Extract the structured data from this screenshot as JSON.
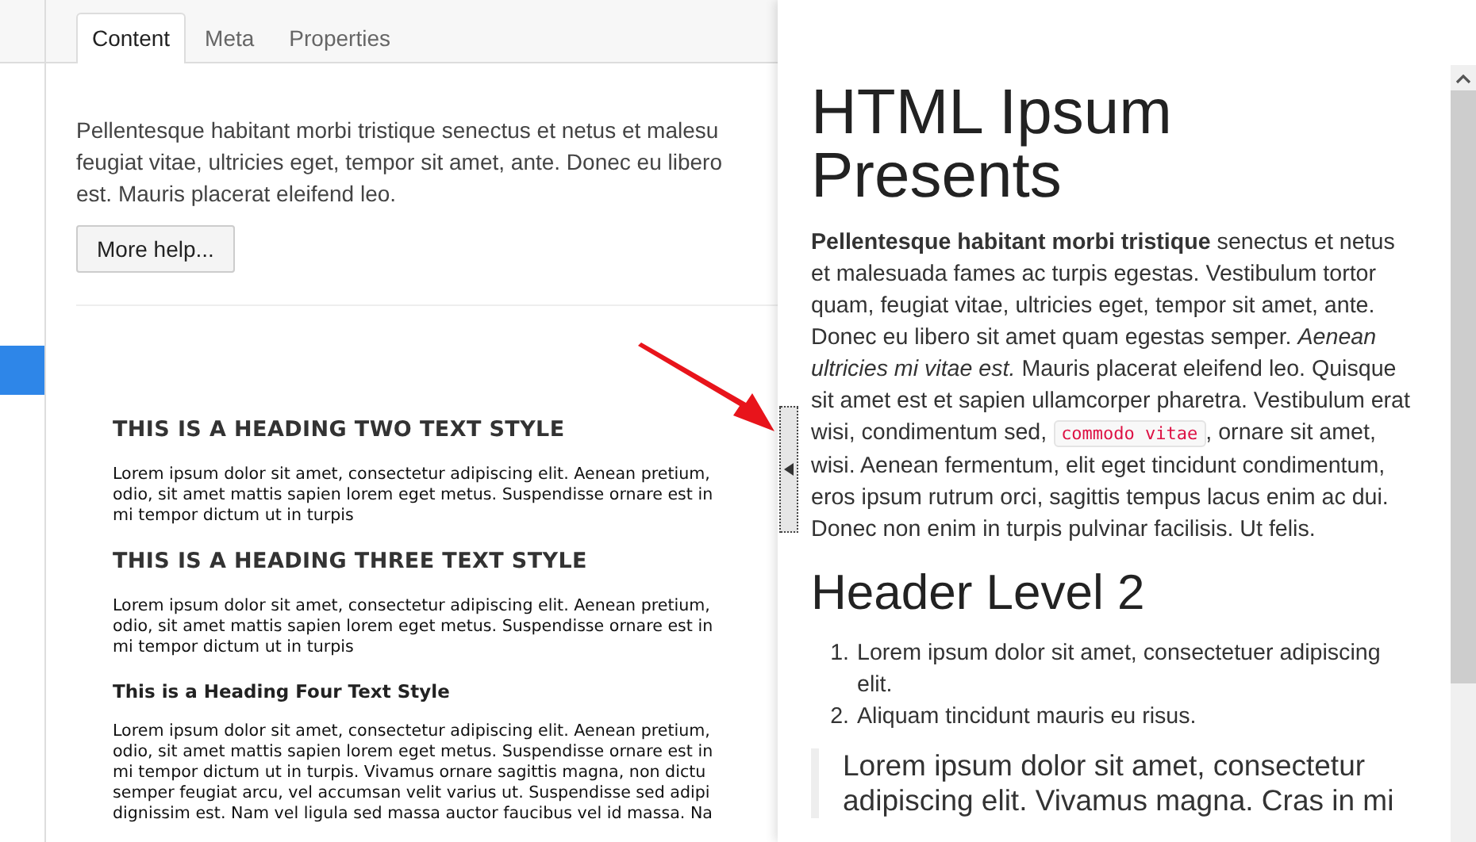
{
  "tabs": [
    {
      "label": "Content",
      "selected": true
    },
    {
      "label": "Meta",
      "selected": false
    },
    {
      "label": "Properties",
      "selected": false
    }
  ],
  "sidebar": {
    "items": [
      {
        "selected": true
      }
    ]
  },
  "help": {
    "lines": [
      "Pellentesque habitant morbi tristique senectus et netus et malesu",
      "feugiat vitae, ultricies eget, tempor sit amet, ante. Donec eu libero",
      "est. Mauris placerat eleifend leo."
    ],
    "button": "More help..."
  },
  "preview": {
    "blocks": [
      {
        "kind": "heading",
        "text": "THIS IS A HEADING TWO TEXT STYLE"
      },
      {
        "kind": "paragraph",
        "lines": [
          "Lorem ipsum dolor sit amet, consectetur adipiscing elit. Aenean pretium,",
          "odio, sit amet mattis sapien lorem eget metus. Suspendisse ornare est in",
          "mi tempor dictum ut in turpis"
        ]
      },
      {
        "kind": "heading",
        "text": "THIS IS A HEADING THREE TEXT STYLE"
      },
      {
        "kind": "paragraph",
        "lines": [
          "Lorem ipsum dolor sit amet, consectetur adipiscing elit. Aenean pretium,",
          "odio, sit amet mattis sapien lorem eget metus. Suspendisse ornare est in",
          "mi tempor dictum ut in turpis"
        ]
      },
      {
        "kind": "subheading",
        "text": "This is a Heading Four Text Style"
      },
      {
        "kind": "paragraph",
        "lines": [
          "Lorem ipsum dolor sit amet, consectetur adipiscing elit. Aenean pretium,",
          "odio, sit amet mattis sapien lorem eget metus. Suspendisse ornare est in",
          "mi tempor dictum ut in turpis. Vivamus ornare sagittis magna, non dictu",
          "semper feugiat arcu, vel accumsan velit varius ut. Suspendisse sed adipi",
          "dignissim est. Nam vel ligula sed massa auctor faucibus vel id massa. Na"
        ]
      }
    ]
  },
  "panel": {
    "title": "HTML Ipsum Presents",
    "paragraph": {
      "before": "**Pellentesque habitant morbi tristique** senectus et netus et malesuada fames ac turpis egestas. Vestibulum tortor quam, feugiat vitae, ultricies eget, tempor sit amet, ante. Donec eu libero sit amet quam egestas semper. *Aenean ultricies mi vitae est.* Mauris placerat eleifend leo. Quisque sit amet est et sapien ullamcorper pharetra. Vestibulum erat wisi, condimentum sed, ",
      "code": "commodo vitae",
      "after": ", ornare sit amet, wisi. Aenean fermentum, elit eget tincidunt condimentum, eros ipsum rutrum orci, sagittis tempus lacus enim ac dui. Donec non enim in turpis pulvinar facilisis. Ut felis."
    },
    "heading": "Header Level 2",
    "list": [
      {
        "number": "1.",
        "text": "Lorem ipsum dolor sit amet, consectetuer adipiscing elit."
      },
      {
        "number": "2.",
        "text": "Aliquam tincidunt mauris eu risus."
      }
    ],
    "quote": "Lorem ipsum dolor sit amet, consectetur adipiscing elit. Vivamus magna. Cras in mi"
  }
}
